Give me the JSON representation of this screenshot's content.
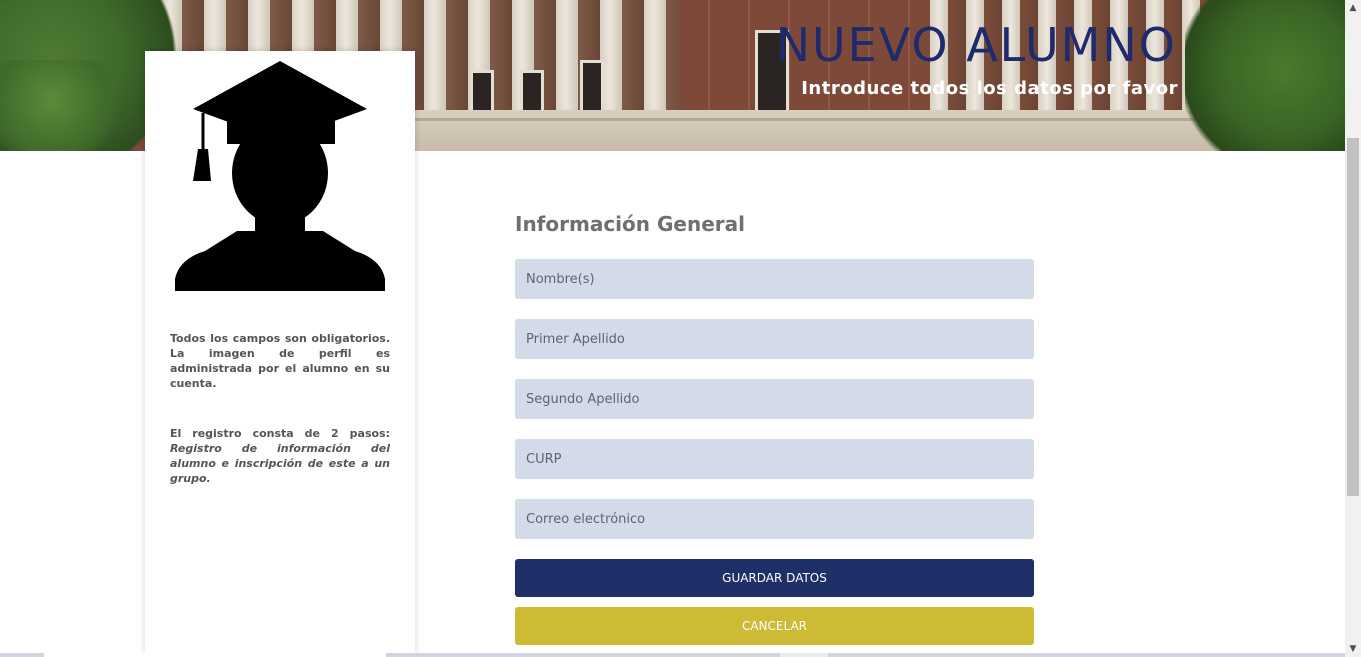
{
  "banner": {
    "title": "NUEVO ALUMNO",
    "subtitle": "Introduce todos los datos por favor"
  },
  "sidebar": {
    "note_required": "Todos los campos son obligatorios. La imagen de perfil es administrada por el alumno en su cuenta.",
    "note_steps_intro": "El registro consta de 2 pasos: ",
    "note_steps_detail": "Registro de información del alumno e inscripción de este a un grupo."
  },
  "form": {
    "section_title": "Información General",
    "fields": {
      "nombre": "Nombre(s)",
      "primer_apellido": "Primer Apellido",
      "segundo_apellido": "Segundo Apellido",
      "curp": "CURP",
      "correo": "Correo electrónico"
    },
    "save_label": "GUARDAR DATOS",
    "cancel_label": "CANCELAR"
  },
  "icons": {
    "avatar": "graduate-silhouette-icon",
    "scroll_up": "arrow-up-icon",
    "scroll_down": "arrow-down-icon"
  },
  "colors": {
    "title": "#1e2a6b",
    "field_bg": "#d3dbe8",
    "save_button": "#1f3068",
    "cancel_button": "#cdbb36"
  }
}
